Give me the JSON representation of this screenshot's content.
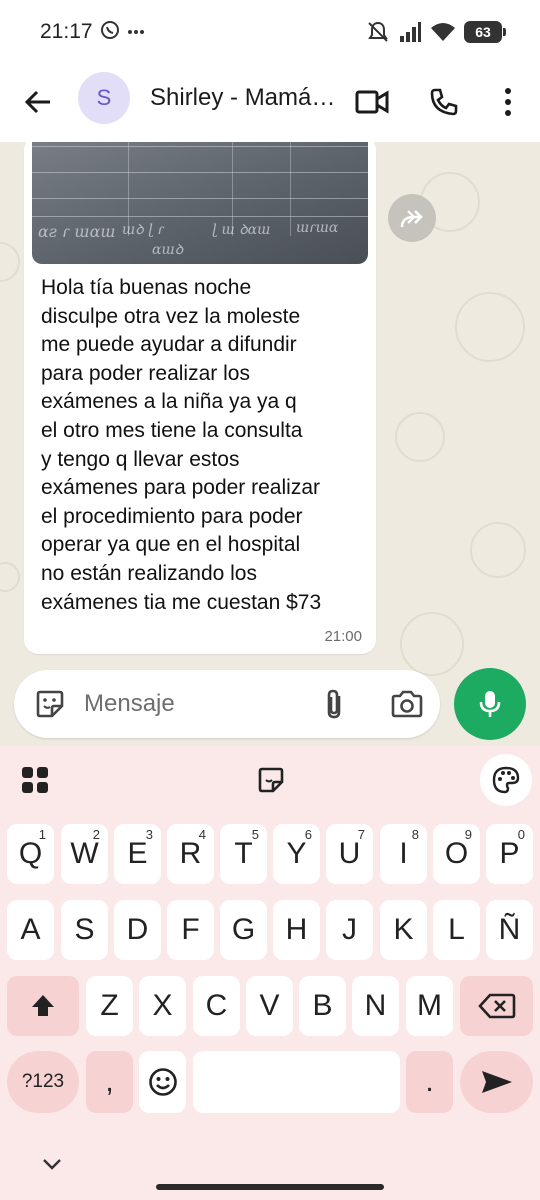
{
  "status_bar": {
    "time": "21:17",
    "battery": "63"
  },
  "header": {
    "avatar_letter": "S",
    "contact_name": "Shirley - Mamá…"
  },
  "message": {
    "text_lines": [
      "Hola tía buenas noche",
      "disculpe otra vez la moleste",
      "me puede ayudar a difundir",
      "para poder realizar los",
      "exámenes a la niña ya ya q",
      "el otro mes tiene la consulta",
      "y tengo q llevar estos",
      "exámenes para poder realizar",
      "el procedimiento para poder",
      "operar ya que en el hospital",
      "no están realizando los",
      "exámenes tia me cuestan $73"
    ],
    "time": "21:00"
  },
  "composer": {
    "placeholder": "Mensaje"
  },
  "keyboard": {
    "row1": [
      {
        "label": "Q",
        "hint": "1"
      },
      {
        "label": "W",
        "hint": "2"
      },
      {
        "label": "E",
        "hint": "3"
      },
      {
        "label": "R",
        "hint": "4"
      },
      {
        "label": "T",
        "hint": "5"
      },
      {
        "label": "Y",
        "hint": "6"
      },
      {
        "label": "U",
        "hint": "7"
      },
      {
        "label": "I",
        "hint": "8"
      },
      {
        "label": "O",
        "hint": "9"
      },
      {
        "label": "P",
        "hint": "0"
      }
    ],
    "row2": [
      "A",
      "S",
      "D",
      "F",
      "G",
      "H",
      "J",
      "K",
      "L",
      "Ñ"
    ],
    "row3": [
      "Z",
      "X",
      "C",
      "V",
      "B",
      "N",
      "M"
    ],
    "symbols_label": "?123",
    "comma_label": ",",
    "period_label": "."
  },
  "colors": {
    "accent_green": "#1daa61",
    "keyboard_bg": "#fbe9e9",
    "function_key": "#f6d3d2",
    "avatar_bg": "#e3def7"
  },
  "icons": [
    "back-arrow-icon",
    "video-call-icon",
    "phone-icon",
    "more-vert-icon",
    "forward-icon",
    "sticker-icon",
    "attach-icon",
    "camera-icon",
    "mic-icon",
    "apps-grid-icon",
    "palette-icon",
    "shift-icon",
    "backspace-icon",
    "emoji-icon",
    "send-icon",
    "chevron-down-icon"
  ]
}
